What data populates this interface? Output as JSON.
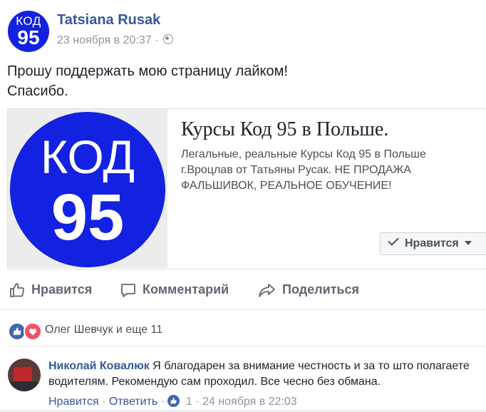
{
  "post": {
    "avatar_line1": "КОД",
    "avatar_line2": "95",
    "author": "Tatsiana Rusak",
    "timestamp": "23 ноября в 20:37 ·",
    "privacy_icon": "globe-icon",
    "text_line1": "Прошу поддержать мою страницу лайком!",
    "text_line2": "Спасибо."
  },
  "card": {
    "logo_line1": "КОД",
    "logo_line2": "95",
    "title": "Курсы Код 95 в Польше.",
    "description": "Легальные, реальные Курсы Код 95 в Польше г.Вроцлав от Татьяны Русак. НЕ ПРОДАЖА ФАЛЬШИВОК, РЕАЛЬНОЕ ОБУЧЕНИЕ!",
    "like_button_label": "Нравится"
  },
  "actions": {
    "like": "Нравится",
    "comment": "Комментарий",
    "share": "Поделиться"
  },
  "reactions": {
    "names": "Олег Шевчук и еще 11"
  },
  "comment": {
    "author": "Николай Ковалюк",
    "text": "Я благодарен за внимание честность и за то што полагаете водителям. Рекомендую сам проходил. Все чесно без обмана.",
    "like_label": "Нравится",
    "reply_label": "Ответить",
    "like_count": "1",
    "timestamp": "24 ноября в 22:03"
  },
  "colors": {
    "brand_blue": "#1222e0",
    "link_blue": "#365899",
    "meta_gray": "#90949c"
  }
}
